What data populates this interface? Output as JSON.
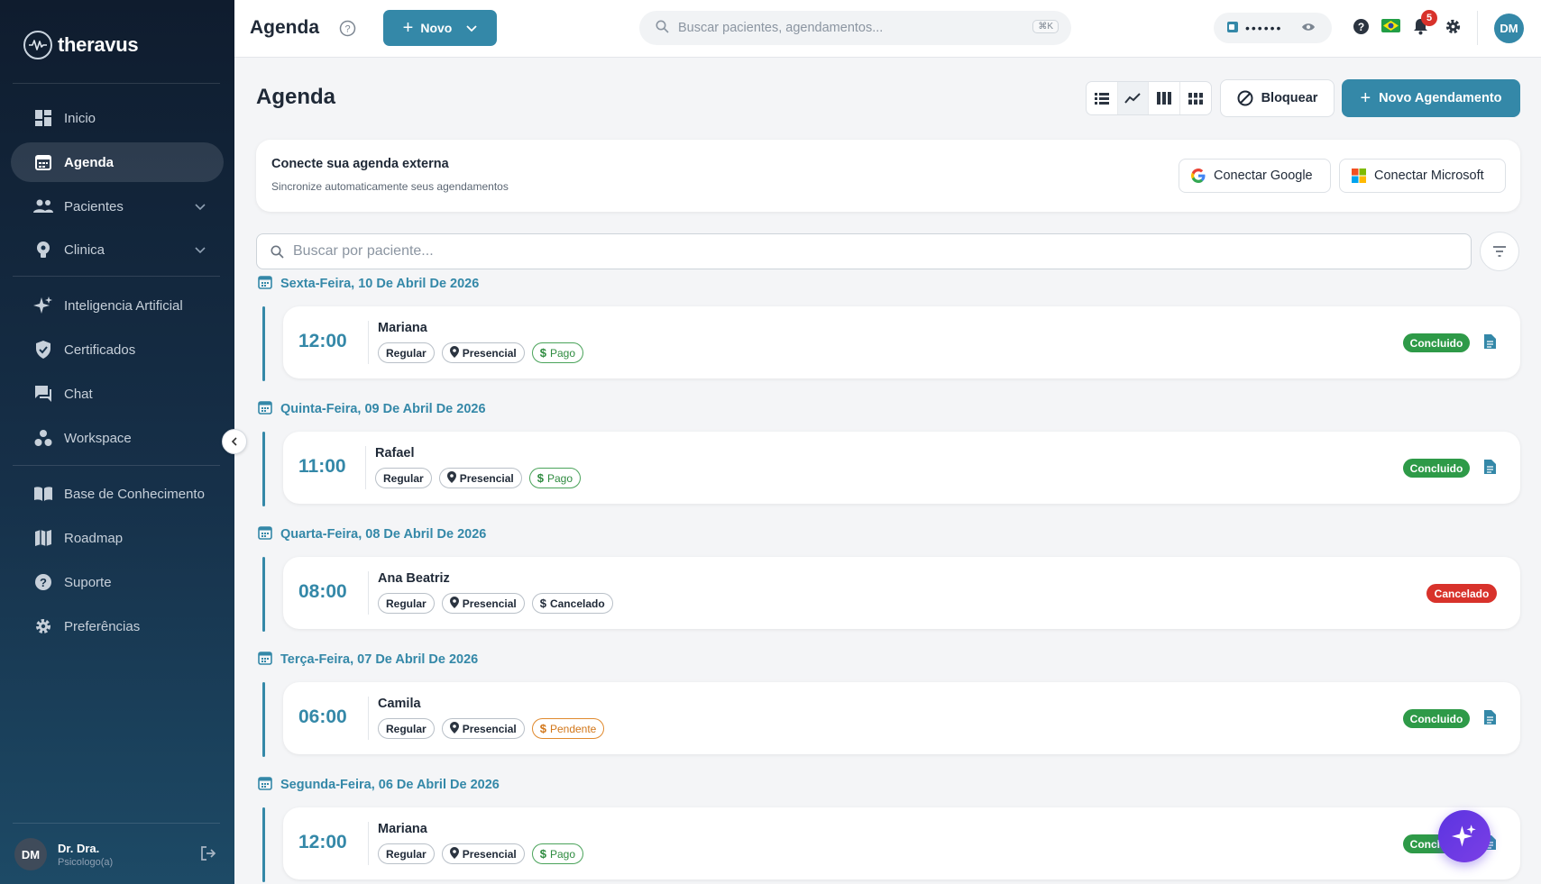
{
  "app": {
    "name": "theravus"
  },
  "sidebar": {
    "items": [
      {
        "label": "Inicio",
        "icon": "dashboard-icon"
      },
      {
        "label": "Agenda",
        "icon": "calendar-icon",
        "active": true
      },
      {
        "label": "Pacientes",
        "icon": "people-icon",
        "expandable": true
      },
      {
        "label": "Clinica",
        "icon": "lightbulb-icon",
        "expandable": true
      },
      {
        "label": "Inteligencia Artificial",
        "icon": "sparkles-icon"
      },
      {
        "label": "Certificados",
        "icon": "shield-check-icon"
      },
      {
        "label": "Chat",
        "icon": "chat-icon"
      },
      {
        "label": "Workspace",
        "icon": "workspace-icon"
      },
      {
        "label": "Base de Conhecimento",
        "icon": "book-icon"
      },
      {
        "label": "Roadmap",
        "icon": "map-icon"
      },
      {
        "label": "Suporte",
        "icon": "help-icon"
      },
      {
        "label": "Preferências",
        "icon": "gear-icon"
      }
    ],
    "user": {
      "initials": "DM",
      "name": "Dr. Dra.",
      "role": "Psicologo(a)"
    }
  },
  "topbar": {
    "title": "Agenda",
    "new_button": "Novo",
    "search_placeholder": "Buscar pacientes, agendamentos...",
    "search_shortcut": "⌘K",
    "wallet_masked": "••••••",
    "notifications_count": "5",
    "avatar_initials": "DM"
  },
  "main": {
    "title": "Agenda",
    "block_button": "Bloquear",
    "new_appointment_button": "Novo Agendamento",
    "connect": {
      "title": "Conecte sua agenda externa",
      "subtitle": "Sincronize automaticamente seus agendamentos",
      "google_button": "Conectar Google",
      "microsoft_button": "Conectar Microsoft"
    },
    "search_placeholder": "Buscar por paciente..."
  },
  "colors": {
    "accent": "#3488a8",
    "success": "#2e9a48",
    "danger": "#d8322b",
    "warning": "#d27618",
    "fab": "#5b34e0"
  },
  "days": [
    {
      "label": "Sexta-Feira, 10 De Abril De 2026",
      "appt": {
        "time": "12:00",
        "patient": "Mariana",
        "type": "Regular",
        "mode": "Presencial",
        "payment": "Pago",
        "payment_kind": "pago",
        "status": "Concluido",
        "status_kind": "ok",
        "has_doc": true
      }
    },
    {
      "label": "Quinta-Feira, 09 De Abril De 2026",
      "appt": {
        "time": "11:00",
        "patient": "Rafael",
        "type": "Regular",
        "mode": "Presencial",
        "payment": "Pago",
        "payment_kind": "pago",
        "status": "Concluido",
        "status_kind": "ok",
        "has_doc": true
      }
    },
    {
      "label": "Quarta-Feira, 08 De Abril De 2026",
      "appt": {
        "time": "08:00",
        "patient": "Ana Beatriz",
        "type": "Regular",
        "mode": "Presencial",
        "payment": "Cancelado",
        "payment_kind": "neutral",
        "status": "Cancelado",
        "status_kind": "cancel",
        "has_doc": false
      }
    },
    {
      "label": "Terça-Feira, 07 De Abril De 2026",
      "appt": {
        "time": "06:00",
        "patient": "Camila",
        "type": "Regular",
        "mode": "Presencial",
        "payment": "Pendente",
        "payment_kind": "pendente",
        "status": "Concluido",
        "status_kind": "ok",
        "has_doc": true
      }
    },
    {
      "label": "Segunda-Feira, 06 De Abril De 2026",
      "appt": {
        "time": "12:00",
        "patient": "Mariana",
        "type": "Regular",
        "mode": "Presencial",
        "payment": "Pago",
        "payment_kind": "pago",
        "status": "Concluido",
        "status_kind": "ok",
        "has_doc": true
      }
    }
  ]
}
